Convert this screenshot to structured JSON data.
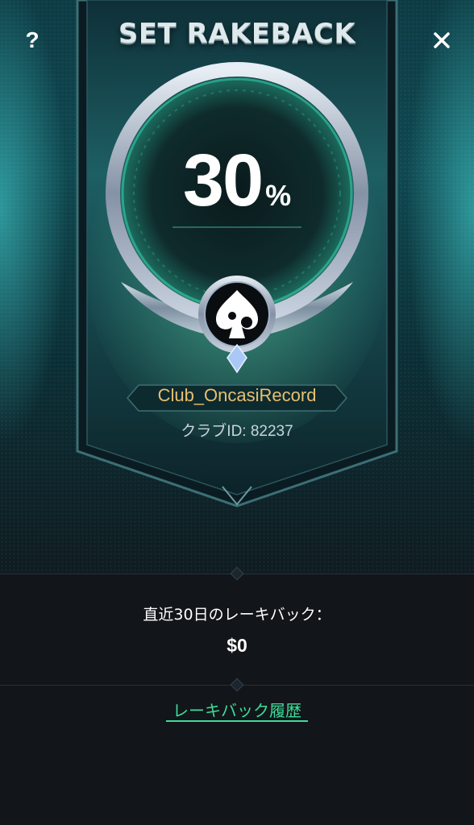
{
  "header": {
    "title": "SET RAKEBACK",
    "help_icon": "question-mark-icon",
    "close_icon": "close-icon"
  },
  "medal": {
    "value": "30",
    "unit": "%",
    "emblem_icon": "spade-emblem-icon"
  },
  "club": {
    "name": "Club_OncasiRecord",
    "id_text": "クラブID: 82237"
  },
  "stats": {
    "recent_label": "直近30日のレーキバック：",
    "recent_value": "$0"
  },
  "footer": {
    "history_link": "レーキバック履歴"
  },
  "colors": {
    "accent_green": "#3ddc9a",
    "club_gold": "#e6c071",
    "background": "#121519"
  }
}
